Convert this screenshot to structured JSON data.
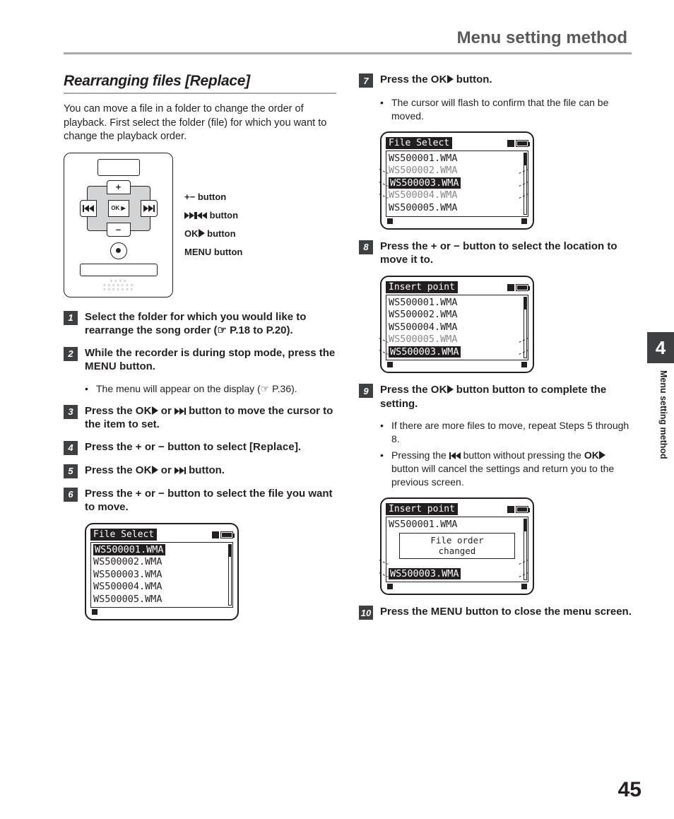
{
  "header": {
    "title": "Menu setting method"
  },
  "section": {
    "title": "Rearranging files [Replace]"
  },
  "intro": "You can move a file in a folder to change the order of playback. First select the folder (file) for which you want to change the playback order.",
  "device_legend": {
    "line1_prefix": "+−",
    "line1_suffix": "button",
    "line2_suffix": "button",
    "line3_prefix": "OK",
    "line3_suffix": "button",
    "line4_prefix": "MENU",
    "line4_suffix": "button"
  },
  "steps": {
    "s1": {
      "num": "1",
      "text_a": "Select the folder for which you would like to rearrange the song order (",
      "text_b": "☞ P.18 to P.20",
      "text_c": ")."
    },
    "s2": {
      "num": "2",
      "text_a": "While the recorder is during stop mode, press the ",
      "text_b": "MENU",
      "text_c": " button."
    },
    "s2_note": "The menu will appear on the display (☞ P.36).",
    "s3": {
      "num": "3",
      "text_a": "Press the ",
      "text_b": "OK",
      "text_c": " or ",
      "text_d": " button to move the cursor to the item to set."
    },
    "s4": {
      "num": "4",
      "text_a": "Press the ",
      "text_b": "+",
      "text_c": " or ",
      "text_d": "−",
      "text_e": " button to select [",
      "text_f": "Replace",
      "text_g": "]."
    },
    "s5": {
      "num": "5",
      "text_a": "Press the ",
      "text_b": "OK",
      "text_c": " or ",
      "text_d": " button."
    },
    "s6": {
      "num": "6",
      "text_a": "Press the ",
      "text_b": "+",
      "text_c": " or ",
      "text_d": "−",
      "text_e": " button to select the file you want to move."
    },
    "s7": {
      "num": "7",
      "text_a": "Press the ",
      "text_b": "OK",
      "text_c": " button."
    },
    "s7_note": "The cursor will flash to confirm that the file can be moved.",
    "s8": {
      "num": "8",
      "text_a": "Press the ",
      "text_b": "+",
      "text_c": " or ",
      "text_d": "−",
      "text_e": " button to select the location to move it to."
    },
    "s9": {
      "num": "9",
      "text_a": "Press the ",
      "text_b": "OK",
      "text_c": " button button to complete the setting."
    },
    "s9_note_a": "If there are more files to move, repeat Steps 5 through 8.",
    "s9_note_b1": "Pressing the ",
    "s9_note_b2": " button without pressing the ",
    "s9_note_b3": "OK",
    "s9_note_b4": " button will cancel the settings and return you to the previous screen.",
    "s10": {
      "num": "10",
      "text_a": "Press the ",
      "text_b": "MENU",
      "text_c": " button to close the menu screen."
    }
  },
  "lcd1": {
    "title": "File Select",
    "rows": [
      "WS500001.WMA",
      "WS500002.WMA",
      "WS500003.WMA",
      "WS500004.WMA",
      "WS500005.WMA"
    ],
    "selected_index": 0
  },
  "lcd2": {
    "title": "File Select",
    "rows": [
      "WS500001.WMA",
      " WS500002.WMA",
      "WS500003.WMA",
      " WS500004.WMA",
      "WS500005.WMA"
    ],
    "selected_index": 2,
    "dim_indices": [
      1,
      3
    ]
  },
  "lcd3": {
    "title": "Insert point",
    "rows": [
      "WS500001.WMA",
      "WS500002.WMA",
      "WS500004.WMA",
      " WS500005.WMA",
      "WS500003.WMA"
    ],
    "selected_index": 4,
    "dim_indices": [
      3
    ]
  },
  "lcd4": {
    "title": "Insert point",
    "rows": [
      "WS500001.WMA",
      "",
      "",
      "",
      " WS500003.WMA"
    ],
    "selected_index": 4,
    "dim_indices": [
      3
    ],
    "dialog_line1": "File order",
    "dialog_line2": "changed"
  },
  "sidebar": {
    "chapter": "4",
    "label": "Menu setting method"
  },
  "page_number": "45"
}
